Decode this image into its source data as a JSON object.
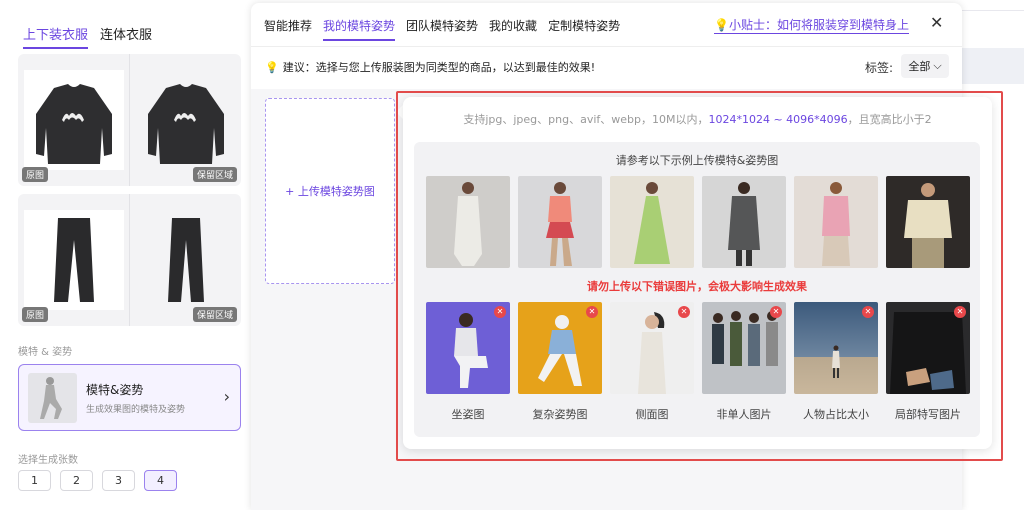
{
  "left": {
    "tabs": [
      {
        "label": "上下装衣服",
        "active": true
      },
      {
        "label": "连体衣服",
        "active": false
      }
    ],
    "garments": [
      {
        "name": "sweater",
        "left_tag": "原图",
        "right_tag": "保留区域"
      },
      {
        "name": "pants",
        "left_tag": "原图",
        "right_tag": "保留区域"
      }
    ],
    "model_section_label": "模特 & 姿势",
    "model_card": {
      "title": "模特&姿势",
      "subtitle": "生成效果图的模特及姿势"
    },
    "count_section_label": "选择生成张数",
    "counts": [
      "1",
      "2",
      "3",
      "4"
    ],
    "selected_count": "4"
  },
  "modal": {
    "tabs": [
      {
        "label": "智能推荐",
        "active": false
      },
      {
        "label": "我的模特姿势",
        "active": true
      },
      {
        "label": "团队模特姿势",
        "active": false
      },
      {
        "label": "我的收藏",
        "active": false
      },
      {
        "label": "定制模特姿势",
        "active": false
      }
    ],
    "tip_label": "小贴士：如何将服装穿到模特身上",
    "advice": "建议：选择与您上传服装图为同类型的商品，以达到最佳的效果!",
    "tag_label": "标签:",
    "tag_value": "全部",
    "upload_label": "+ 上传模特姿势图"
  },
  "popover": {
    "support_prefix": "支持jpg、jpeg、png、avif、webp，10M以内，",
    "support_size": "1024*1024 ~ 4096*4096",
    "support_suffix": "，且宽高比小于2",
    "example_title": "请参考以下示例上传模特&姿势图",
    "warning": "请勿上传以下错误图片，会极大影响生成效果",
    "bad_examples": [
      "坐姿图",
      "复杂姿势图",
      "侧面图",
      "非单人图片",
      "人物占比太小",
      "局部特写图片"
    ]
  },
  "colors": {
    "accent": "#6b46e0",
    "warning": "#ea3b3b",
    "highlight_border": "#e24b4b"
  }
}
